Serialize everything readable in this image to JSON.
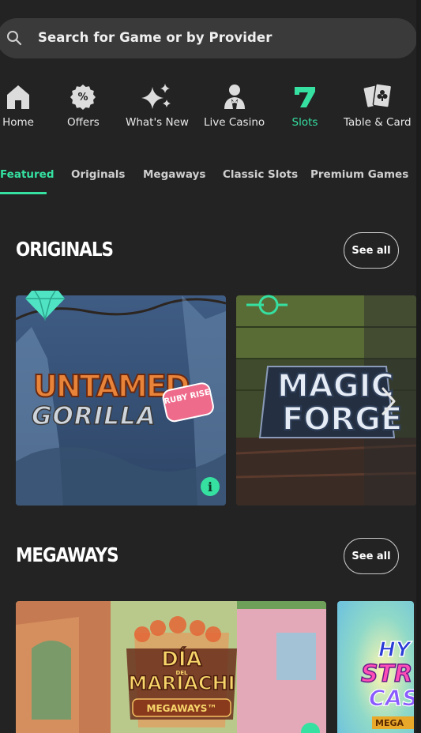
{
  "search": {
    "placeholder": "Search for Game or by Provider"
  },
  "categories": [
    {
      "label": "Home",
      "icon": "home-icon"
    },
    {
      "label": "Offers",
      "icon": "percent-badge-icon"
    },
    {
      "label": "What's New",
      "icon": "sparkles-icon"
    },
    {
      "label": "Live Casino",
      "icon": "dealer-icon"
    },
    {
      "label": "Slots",
      "icon": "seven-icon",
      "active": true
    },
    {
      "label": "Table & Card",
      "icon": "playing-cards-icon"
    }
  ],
  "tabs": [
    {
      "label": "Featured",
      "active": true
    },
    {
      "label": "Originals"
    },
    {
      "label": "Megaways"
    },
    {
      "label": "Classic Slots"
    },
    {
      "label": "Premium Games"
    }
  ],
  "sections": [
    {
      "title": "ORIGINALS",
      "see_all": "See all",
      "games": [
        {
          "title_line1": "UNTAMED",
          "title_line2": "GORILLA",
          "badge": "RUBY RISE"
        },
        {
          "title_line1": "MAGIC",
          "title_line2": "FORGE"
        }
      ]
    },
    {
      "title": "MEGAWAYS",
      "see_all": "See all",
      "games": [
        {
          "title_line1": "DÍA",
          "title_line2": "MARIACHI",
          "sub": "MEGAWAYS™",
          "small": "DEL"
        },
        {
          "title_line1": "HY",
          "title_line2": "STR",
          "title_line3": "CAS",
          "sub": "MEGA"
        }
      ]
    }
  ],
  "colors": {
    "accent": "#35e0a1",
    "background": "#232323",
    "search_bg": "#3a3a3a"
  }
}
